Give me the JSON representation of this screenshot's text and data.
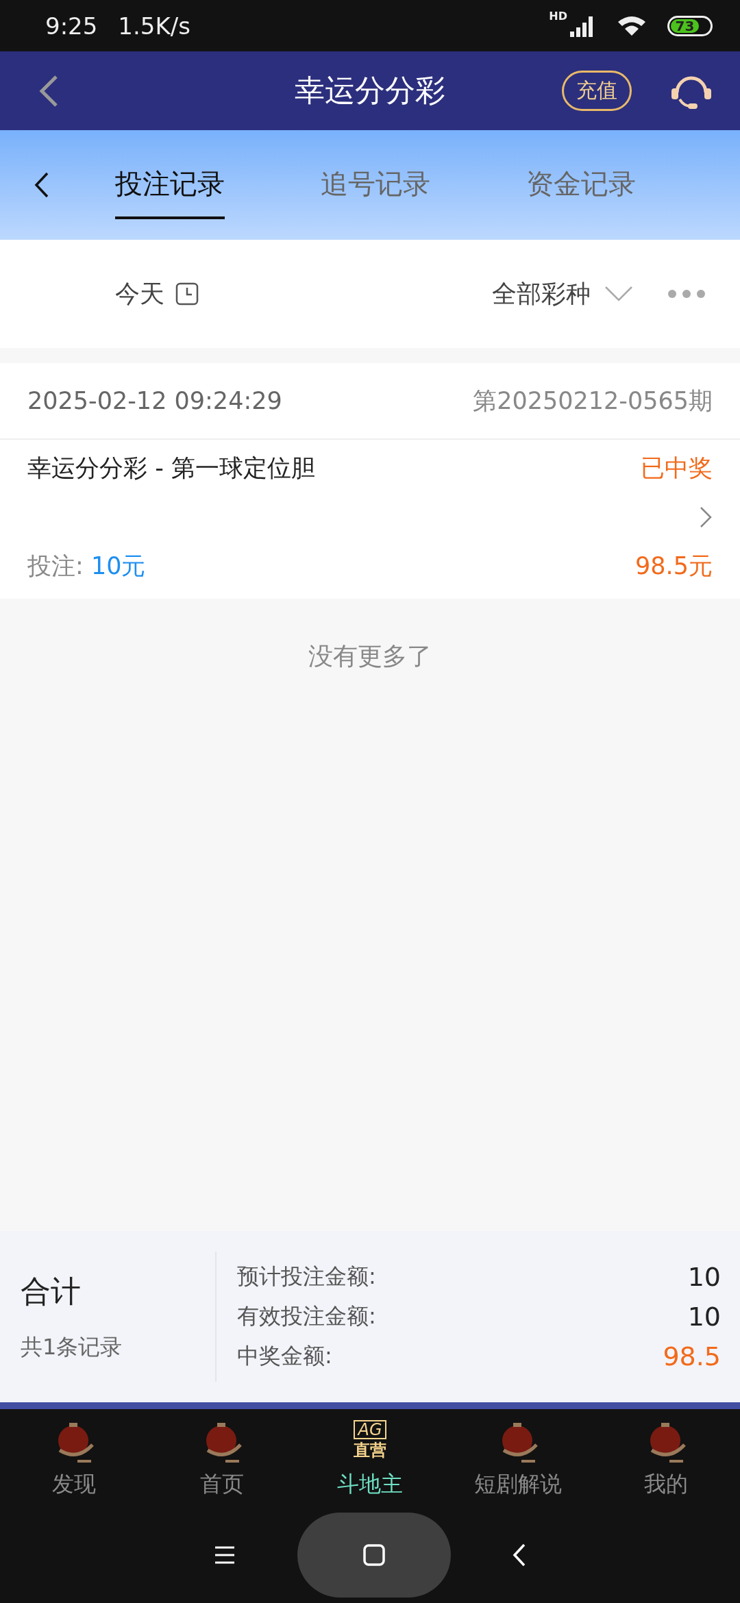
{
  "status_bar": {
    "time": "9:25",
    "speed": "1.5K/s",
    "network": "HD",
    "battery": "73"
  },
  "header": {
    "title": "幸运分分彩",
    "recharge": "充值"
  },
  "tabs": [
    {
      "label": "投注记录",
      "selected": true
    },
    {
      "label": "追号记录",
      "selected": false
    },
    {
      "label": "资金记录",
      "selected": false
    }
  ],
  "filter": {
    "date": "今天",
    "lottery": "全部彩种"
  },
  "records": [
    {
      "time": "2025-02-12 09:24:29",
      "issue": "第20250212-0565期",
      "game": "幸运分分彩 - 第一球定位胆",
      "status": "已中奖",
      "bet_label": "投注:",
      "bet_amount": "10元",
      "prize": "98.5元"
    }
  ],
  "end_note": "没有更多了",
  "summary": {
    "title": "合计",
    "count": "共1条记录",
    "rows": [
      {
        "label": "预计投注金额:",
        "value": "10",
        "highlight": false
      },
      {
        "label": "有效投注金额:",
        "value": "10",
        "highlight": false
      },
      {
        "label": "中奖金额:",
        "value": "98.5",
        "highlight": true
      }
    ]
  },
  "bottom_nav": [
    {
      "label": "发现",
      "kind": "lantern",
      "selected": false
    },
    {
      "label": "首页",
      "kind": "lantern",
      "selected": false
    },
    {
      "label": "斗地主",
      "kind": "badge",
      "badge_top": "AG",
      "badge_bottom": "直营",
      "selected": true
    },
    {
      "label": "短剧解说",
      "kind": "lantern",
      "selected": false
    },
    {
      "label": "我的",
      "kind": "lantern",
      "selected": false
    }
  ]
}
